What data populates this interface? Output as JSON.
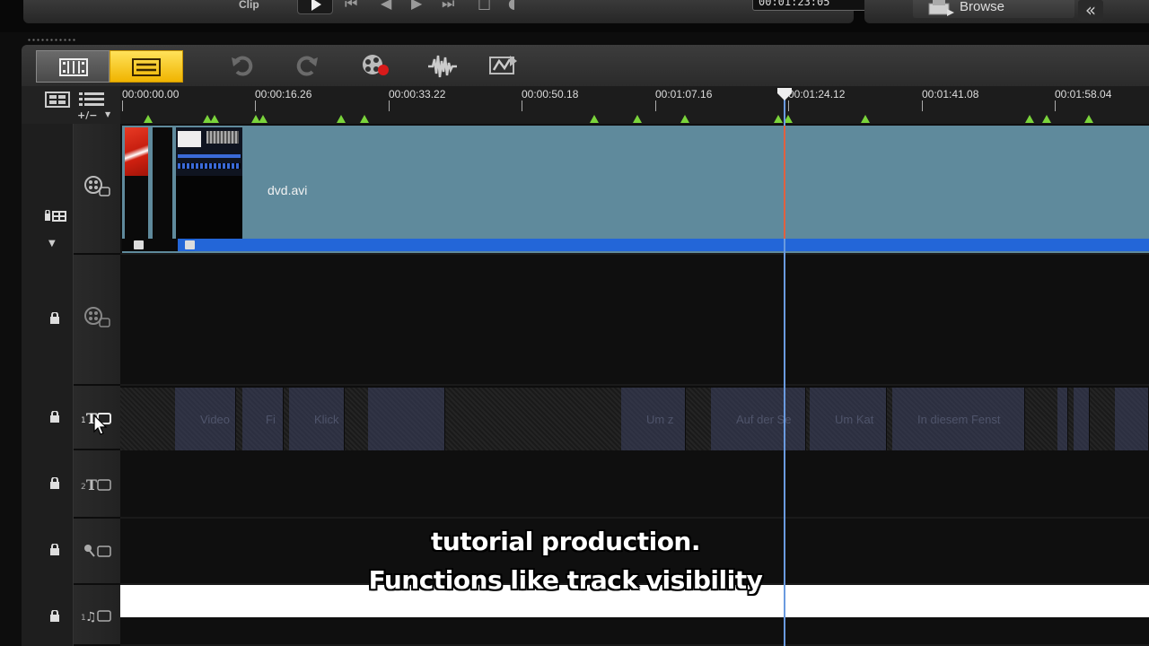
{
  "player": {
    "clip_label": "Clip",
    "timecode": "00:01:23:05"
  },
  "library": {
    "browse_label": "Browse",
    "collapse_glyph": "«"
  },
  "toolbar": {
    "storyboard_view": "storyboard-view-icon",
    "timeline_view": "timeline-view-icon",
    "undo": "undo-icon",
    "redo": "redo-icon",
    "record_capture": "record-capture-icon",
    "sound_mixer": "sound-mixer-icon",
    "auto_music": "auto-music-icon"
  },
  "ruler": {
    "zoom_label": "+/−",
    "ticks": [
      "00:00:00.00",
      "00:00:16.26",
      "00:00:33.22",
      "00:00:50.18",
      "00:01:07.16",
      "00:01:24.12",
      "00:01:41.08",
      "00:01:58.04"
    ]
  },
  "video_track": {
    "clip_name": "dvd.avi"
  },
  "title_track": {
    "clips": [
      "Video",
      "Fi",
      "Klick",
      "Um z",
      "Auf der Se",
      "Um Kat",
      "In diesem Fenst"
    ]
  },
  "subtitles": {
    "line1": "tutorial production.",
    "line2": "Functions like track visibility"
  },
  "colors": {
    "accent": "#f0b400",
    "clip": "#5f8a9c",
    "audio": "#2366d8",
    "playhead": "#6a9adf",
    "marker": "#7ad43b"
  }
}
